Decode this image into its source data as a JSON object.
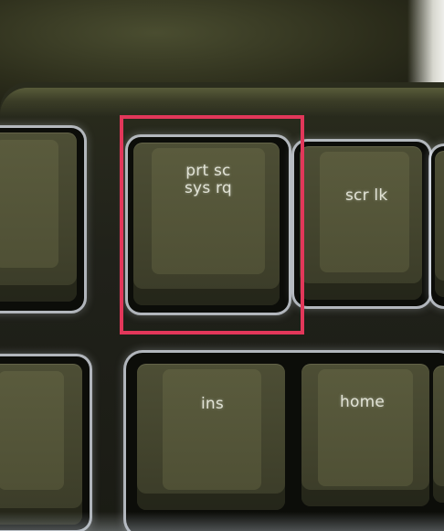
{
  "keys": {
    "print_screen": {
      "line1": "prt sc",
      "line2": "sys rq"
    },
    "scroll_lock": {
      "label": "scr lk"
    },
    "insert": {
      "label": "ins"
    },
    "home": {
      "label": "home"
    }
  },
  "annotation": {
    "highlight_color": "#e2375a",
    "highlighted_key": "print_screen"
  },
  "colors": {
    "keycap": "#4d4e35",
    "backlight": "#d7dce6",
    "legend": "#e2e3d6"
  }
}
